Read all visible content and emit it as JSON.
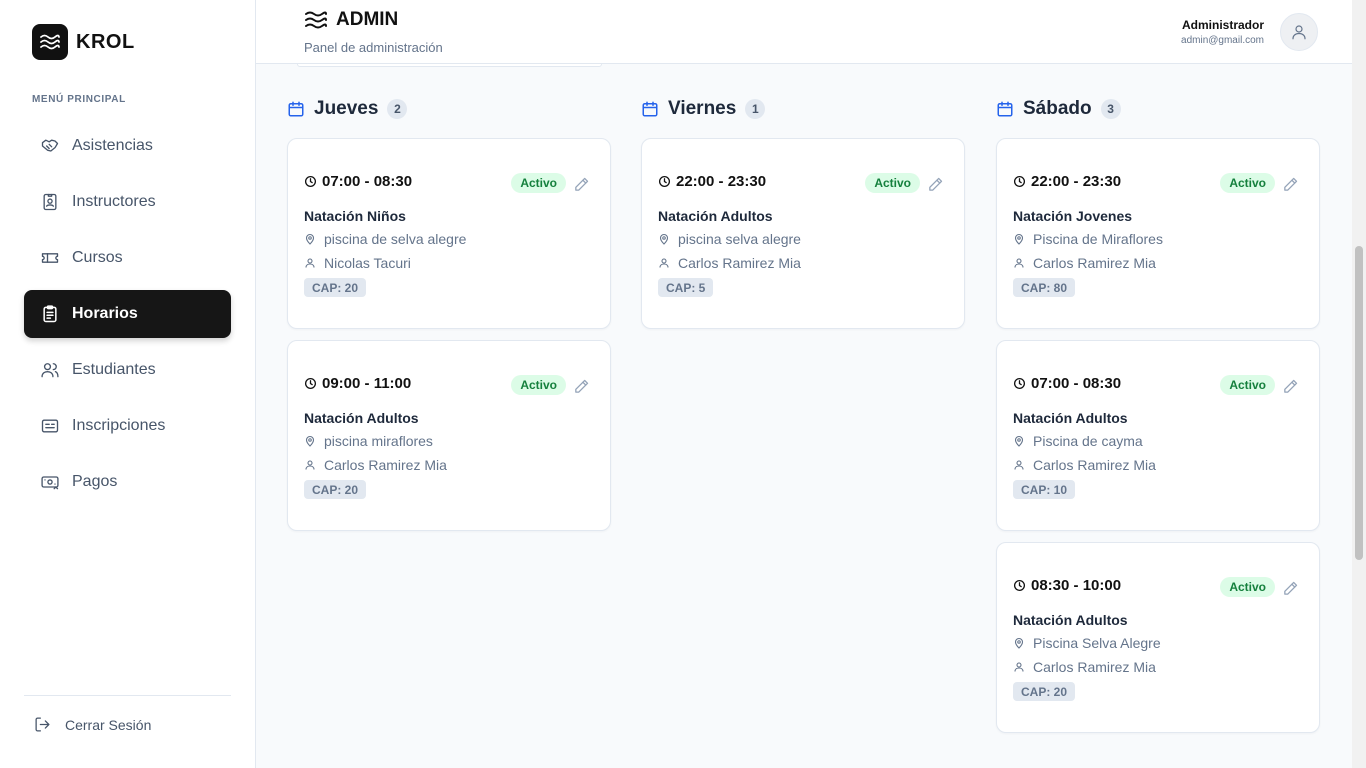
{
  "app": {
    "brand": "KROL"
  },
  "sidebar": {
    "menu_title": "MENÚ PRINCIPAL",
    "items": [
      {
        "label": "Asistencias",
        "icon": "handshake-icon",
        "active": false
      },
      {
        "label": "Instructores",
        "icon": "id-badge-icon",
        "active": false
      },
      {
        "label": "Cursos",
        "icon": "ticket-icon",
        "active": false
      },
      {
        "label": "Horarios",
        "icon": "clipboard-icon",
        "active": true
      },
      {
        "label": "Estudiantes",
        "icon": "users-icon",
        "active": false
      },
      {
        "label": "Inscripciones",
        "icon": "id-card-icon",
        "active": false
      },
      {
        "label": "Pagos",
        "icon": "money-icon",
        "active": false
      }
    ],
    "logout_label": "Cerrar Sesión"
  },
  "header": {
    "title": "ADMIN",
    "subtitle": "Panel de administración",
    "user_name": "Administrador",
    "user_email": "admin@gmail.com"
  },
  "colors": {
    "active_bg": "#161616",
    "accent": "#2563eb",
    "status_bg": "#dcfce7",
    "status_text": "#15803d"
  },
  "columns": [
    {
      "day": "Jueves",
      "count": "2",
      "cards": [
        {
          "time": "07:00 - 08:30",
          "status": "Activo",
          "course": "Natación Niños",
          "location": "piscina de selva alegre",
          "instructor": "Nicolas Tacuri",
          "capacity": "CAP: 20"
        },
        {
          "time": "09:00 - 11:00",
          "status": "Activo",
          "course": "Natación Adultos",
          "location": "piscina miraflores",
          "instructor": "Carlos Ramirez Mia",
          "capacity": "CAP: 20"
        }
      ]
    },
    {
      "day": "Viernes",
      "count": "1",
      "cards": [
        {
          "time": "22:00 - 23:30",
          "status": "Activo",
          "course": "Natación Adultos",
          "location": "piscina selva alegre",
          "instructor": "Carlos Ramirez Mia",
          "capacity": "CAP: 5"
        }
      ]
    },
    {
      "day": "Sábado",
      "count": "3",
      "cards": [
        {
          "time": "22:00 - 23:30",
          "status": "Activo",
          "course": "Natación Jovenes",
          "location": "Piscina de Miraflores",
          "instructor": "Carlos Ramirez Mia",
          "capacity": "CAP: 80"
        },
        {
          "time": "07:00 - 08:30",
          "status": "Activo",
          "course": "Natación Adultos",
          "location": "Piscina de cayma",
          "instructor": "Carlos Ramirez Mia",
          "capacity": "CAP: 10"
        },
        {
          "time": "08:30 - 10:00",
          "status": "Activo",
          "course": "Natación Adultos",
          "location": "Piscina Selva Alegre",
          "instructor": "Carlos Ramirez Mia",
          "capacity": "CAP: 20"
        }
      ]
    }
  ]
}
